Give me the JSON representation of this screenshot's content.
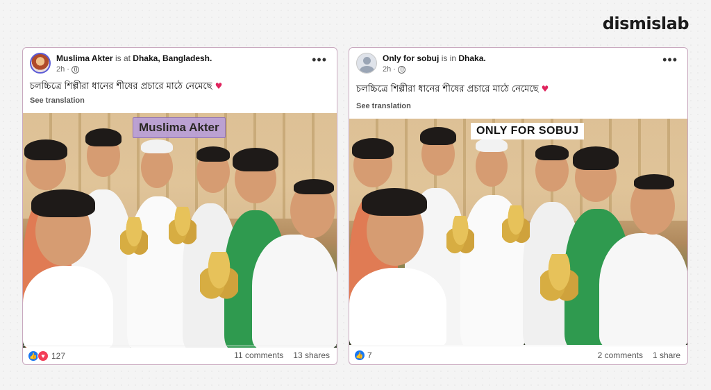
{
  "brand": "dismislab",
  "posts": [
    {
      "author": "Muslima Akter",
      "location_prefix": "is at",
      "location": "Dhaka, Bangladesh.",
      "time": "2h",
      "caption": "চলচ্চিত্রে শিল্পীরা ধানের শীষের প্রচারে মাঠে নেমেছে",
      "see_translation": "See translation",
      "overlay_tag": "Muslima Akter",
      "reaction_count": "127",
      "comments": "11 comments",
      "shares": "13 shares"
    },
    {
      "author": "Only for sobuj",
      "location_prefix": "is in",
      "location": "Dhaka.",
      "time": "2h",
      "caption": "চলচ্চিত্রে শিল্পীরা ধানের শীষের প্রচারে মাঠে নেমেছে",
      "see_translation": "See translation",
      "overlay_tag": "ONLY FOR SOBUJ",
      "reaction_count": "7",
      "comments": "2 comments",
      "shares": "1 share"
    }
  ],
  "icons": [
    "more-options-icon",
    "globe-icon",
    "like-icon",
    "love-icon",
    "heart-emoji-icon",
    "avatar-icon"
  ],
  "colors": {
    "like": "#1877f2",
    "love": "#f33e58",
    "card_border": "#c9a9bf"
  }
}
